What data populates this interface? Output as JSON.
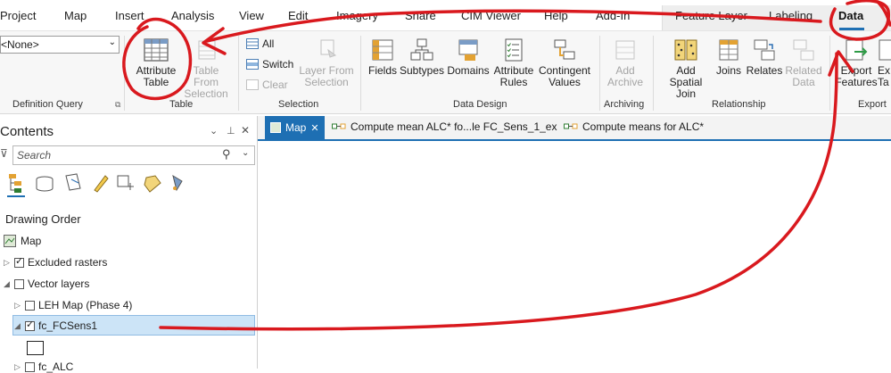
{
  "ribbon_tabs": [
    "Project",
    "Map",
    "Insert",
    "Analysis",
    "View",
    "Edit",
    "Imagery",
    "Share",
    "CIM Viewer",
    "Help",
    "Add-In",
    "Feature Layer",
    "Labeling",
    "Data"
  ],
  "definition_query": {
    "value": "<None>",
    "group_label": "Definition Query"
  },
  "table_group": {
    "label": "Table",
    "attribute_table": "Attribute\nTable",
    "table_from_selection": "Table From\nSelection"
  },
  "selection_group": {
    "label": "Selection",
    "all": "All",
    "switch": "Switch",
    "clear": "Clear",
    "layer_from_selection": "Layer From\nSelection"
  },
  "data_design_group": {
    "label": "Data Design",
    "fields": "Fields",
    "subtypes": "Subtypes",
    "domains": "Domains",
    "attribute_rules": "Attribute\nRules",
    "contingent_values": "Contingent\nValues"
  },
  "archiving_group": {
    "label": "Archiving",
    "add_archive": "Add\nArchive"
  },
  "relationship_group": {
    "label": "Relationship",
    "add_spatial_join": "Add\nSpatial Join",
    "joins": "Joins",
    "relates": "Relates",
    "related_data": "Related\nData"
  },
  "export_group": {
    "label": "Export",
    "export_features": "Export\nFeatures",
    "export_table": "Ex\nTa"
  },
  "contents": {
    "title": "Contents",
    "search_placeholder": "Search",
    "section_title": "Drawing Order",
    "items": [
      "Map",
      "Excluded rasters",
      "Vector layers",
      "LEH Map (Phase 4)",
      "fc_FCSens1",
      "fc_ALC"
    ]
  },
  "doc_tabs": [
    "Map",
    "Compute mean ALC* fo...le FC_Sens_1_ex",
    "Compute means for ALC*"
  ],
  "colors": {
    "accent": "#1e6fb3",
    "annotation": "#d9191e",
    "selected": "#cce4f7"
  }
}
